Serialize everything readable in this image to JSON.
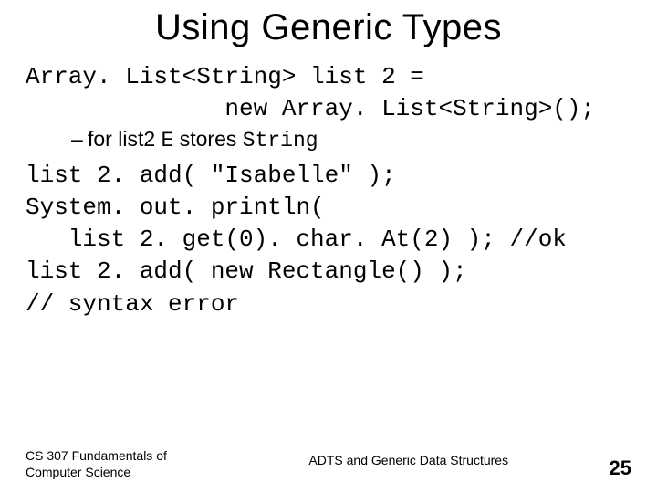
{
  "title": "Using Generic Types",
  "code": {
    "line1": "Array. List<String> list 2 =",
    "line2": "              new Array. List<String>();",
    "line3": "list 2. add( \"Isabelle\" );",
    "line4": "System. out. println(",
    "line5": "   list 2. get(0). char. At(2) ); //ok",
    "line6": "list 2. add( new Rectangle() );",
    "line7": "// syntax error"
  },
  "bullet": {
    "prefix": "for list2 ",
    "mono1": "E",
    "mid": " stores ",
    "mono2": "String"
  },
  "footer": {
    "left": "CS 307 Fundamentals of Computer Science",
    "center": "ADTS and Generic Data Structures",
    "right": "25"
  }
}
